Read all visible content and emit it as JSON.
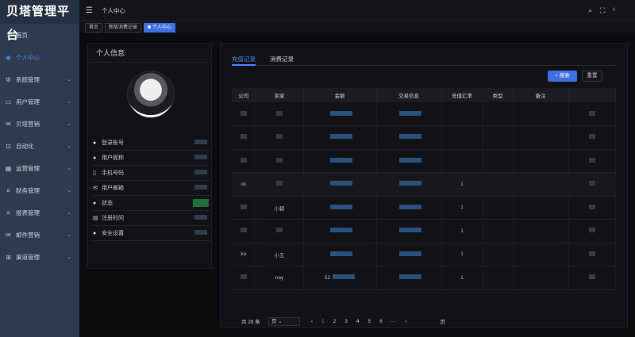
{
  "app": {
    "title": "贝塔管理平台"
  },
  "sidebar": {
    "items": [
      {
        "label": "首页",
        "icon": "home-icon",
        "expandable": false,
        "active": false
      },
      {
        "label": "个人中心",
        "icon": "user-circle-icon",
        "expandable": false,
        "active": true
      },
      {
        "label": "系统管理",
        "icon": "gear-icon",
        "expandable": true,
        "active": false
      },
      {
        "label": "用户管理",
        "icon": "folder-icon",
        "expandable": true,
        "active": false
      },
      {
        "label": "贝塔营销",
        "icon": "chat-icon",
        "expandable": true,
        "active": false
      },
      {
        "label": "自动化",
        "icon": "robot-icon",
        "expandable": true,
        "active": false
      },
      {
        "label": "运营管理",
        "icon": "chart-icon",
        "expandable": true,
        "active": false
      },
      {
        "label": "财务管理",
        "icon": "coin-icon",
        "expandable": true,
        "active": false
      },
      {
        "label": "报表管理",
        "icon": "list-icon",
        "expandable": true,
        "active": false
      },
      {
        "label": "邮件营销",
        "icon": "mail-icon",
        "expandable": true,
        "active": false
      },
      {
        "label": "渠道管理",
        "icon": "channel-icon",
        "expandable": true,
        "active": false
      }
    ]
  },
  "header": {
    "breadcrumb": "个人中心"
  },
  "tags": [
    {
      "label": "首页",
      "active": false
    },
    {
      "label": "新版消费记录",
      "active": false
    },
    {
      "label": "个人中心",
      "active": true
    }
  ],
  "profile": {
    "title": "个人信息",
    "rows": [
      {
        "label": "登录账号",
        "icon": "user-icon"
      },
      {
        "label": "用户昵称",
        "icon": "user-icon"
      },
      {
        "label": "手机号码",
        "icon": "phone-icon"
      },
      {
        "label": "用户邮箱",
        "icon": "mail-icon"
      },
      {
        "label": "状态",
        "icon": "user-icon"
      },
      {
        "label": "注册时间",
        "icon": "calendar-icon"
      },
      {
        "label": "安全设置",
        "icon": "user-icon"
      }
    ]
  },
  "records": {
    "tabs": [
      {
        "label": "充值记录",
        "active": true
      },
      {
        "label": "消费记录",
        "active": false
      }
    ],
    "search_label": "搜索",
    "reset_label": "重置",
    "columns": [
      "公司",
      "卖家",
      "金额",
      "交易信息",
      "充值汇率",
      "类型",
      "备注"
    ],
    "rows": [
      {
        "company": "",
        "seller": "",
        "amount": "",
        "info": "",
        "rate": "",
        "type": "",
        "note": ""
      },
      {
        "company": "",
        "seller": "",
        "amount": "",
        "info": "",
        "rate": "",
        "type": "",
        "note": ""
      },
      {
        "company": "",
        "seller": "",
        "amount": "",
        "info": "",
        "rate": "",
        "type": "",
        "note": ""
      },
      {
        "company": "ok",
        "seller": "",
        "amount": "",
        "info": "",
        "rate": "1",
        "type": "",
        "note": ""
      },
      {
        "company": "",
        "seller": "小碧",
        "amount": "",
        "info": "",
        "rate": "1",
        "type": "",
        "note": ""
      },
      {
        "company": "",
        "seller": "",
        "amount": "",
        "info": "",
        "rate": "1",
        "type": "",
        "note": ""
      },
      {
        "company": "ko",
        "seller": "小五",
        "amount": "",
        "info": "",
        "rate": "1",
        "type": "",
        "note": ""
      },
      {
        "company": "",
        "seller": "nay",
        "amount": "52",
        "info": "",
        "rate": "1",
        "type": "",
        "note": ""
      }
    ],
    "pager": {
      "total": "共 28 条",
      "page_size": "页",
      "pages": [
        "1",
        "2",
        "3",
        "4",
        "5",
        "6"
      ],
      "current": "1",
      "goto_suffix": "页"
    }
  }
}
